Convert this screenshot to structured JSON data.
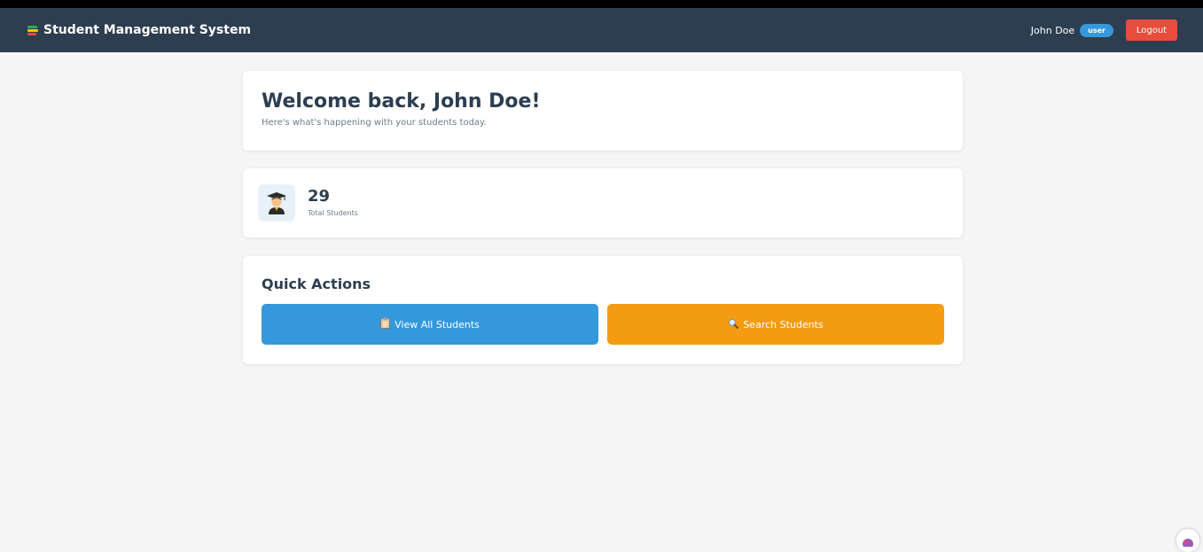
{
  "navbar": {
    "brand_title": "Student Management System",
    "brand_icon": "books-icon",
    "user_name": "John Doe",
    "role_badge": "user",
    "logout_label": "Logout"
  },
  "welcome": {
    "title": "Welcome back, John Doe!",
    "subtitle": "Here's what's happening with your students today."
  },
  "stats": {
    "icon": "graduate-icon",
    "value": "29",
    "label": "Total Students"
  },
  "quick_actions": {
    "title": "Quick Actions",
    "view_all": {
      "icon": "clipboard-icon",
      "label": "View All Students"
    },
    "search": {
      "icon": "magnifier-icon",
      "label": "Search Students"
    }
  },
  "colors": {
    "navbar_bg": "#2c3e50",
    "page_bg": "#f5f5f5",
    "primary": "#3498db",
    "warning": "#f39c12",
    "danger": "#e74c3c"
  }
}
